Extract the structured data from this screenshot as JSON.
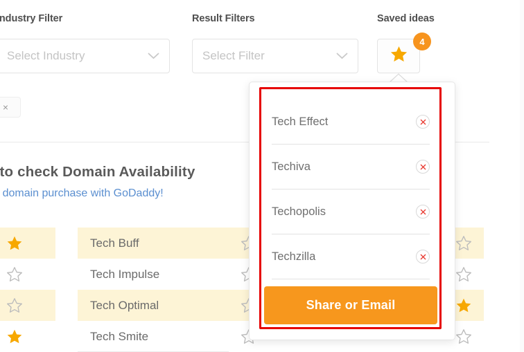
{
  "filters": {
    "industry": {
      "label": "Industry Filter",
      "placeholder": "Select Industry",
      "value": "",
      "chevron_icon": "chevron-down-icon"
    },
    "result": {
      "label": "Result Filters",
      "placeholder": "Select Filter",
      "value": "",
      "chevron_icon": "chevron-down-icon"
    },
    "saved": {
      "label": "Saved ideas",
      "badge_count": "4",
      "star_icon": "star-filled-icon"
    },
    "clear_chip_label": "×"
  },
  "promo": {
    "title": "e to check Domain Availability",
    "subtitle": "your domain purchase with GoDaddy!"
  },
  "saved_panel": {
    "items": [
      {
        "name": "Tech Effect",
        "remove_icon": "remove-circle-icon"
      },
      {
        "name": "Techiva",
        "remove_icon": "remove-circle-icon"
      },
      {
        "name": "Techopolis",
        "remove_icon": "remove-circle-icon"
      },
      {
        "name": "Techzilla",
        "remove_icon": "remove-circle-icon"
      }
    ],
    "share_label": "Share or Email",
    "highlight_color": "#e60000"
  },
  "results": {
    "rows": [
      {
        "name": "Tech Buff",
        "left_saved": true,
        "mid_saved": false,
        "right_saved": false,
        "highlighted": true
      },
      {
        "name": "Tech Impulse",
        "left_saved": false,
        "mid_saved": false,
        "right_saved": false,
        "highlighted": false
      },
      {
        "name": "Tech Optimal",
        "left_saved": false,
        "mid_saved": false,
        "right_saved": true,
        "highlighted": true
      },
      {
        "name": "Tech Smite",
        "left_saved": true,
        "mid_saved": false,
        "right_saved": false,
        "highlighted": false
      }
    ]
  },
  "colors": {
    "brand_orange": "#f7941e",
    "highlight_row": "#fdf4d6",
    "link_blue": "#5b8fd0",
    "remove_red": "#e8392f"
  }
}
